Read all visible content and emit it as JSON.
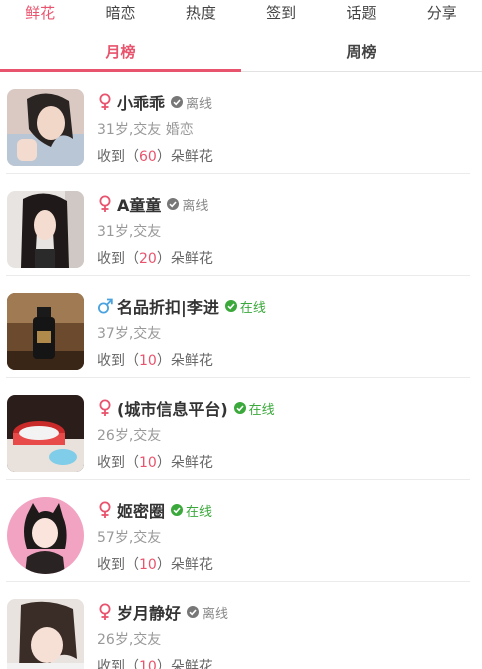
{
  "top_tabs": [
    "鲜花",
    "暗恋",
    "热度",
    "签到",
    "话题",
    "分享"
  ],
  "sub_tabs": [
    "月榜",
    "周榜"
  ],
  "colors": {
    "accent": "#e8546d",
    "online": "#3aa83a",
    "offline": "#888888",
    "female": "#e8546d",
    "male": "#4aa3df"
  },
  "labels": {
    "received_prefix": "收到（",
    "received_suffix": "）朵鲜花"
  },
  "users": [
    {
      "name": "小乖乖",
      "gender": "female",
      "gender_icon": "female-symbol-icon",
      "status": "离线",
      "status_kind": "offline",
      "info": "31岁,交友 婚恋",
      "flowers": "60"
    },
    {
      "name": "A童童",
      "gender": "female",
      "gender_icon": "female-symbol-icon",
      "status": "离线",
      "status_kind": "offline",
      "info": "31岁,交友",
      "flowers": "20"
    },
    {
      "name": "名品折扣|李进",
      "gender": "male",
      "gender_icon": "male-symbol-icon",
      "status": "在线",
      "status_kind": "online",
      "info": "37岁,交友",
      "flowers": "10"
    },
    {
      "name": "(城市信息平台)",
      "gender": "female",
      "gender_icon": "female-symbol-icon",
      "status": "在线",
      "status_kind": "online",
      "info": "26岁,交友",
      "flowers": "10"
    },
    {
      "name": "姬密圈",
      "gender": "female",
      "gender_icon": "female-symbol-icon",
      "status": "在线",
      "status_kind": "online",
      "info": "57岁,交友",
      "flowers": "10"
    },
    {
      "name": "岁月静好",
      "gender": "female",
      "gender_icon": "female-symbol-icon",
      "status": "离线",
      "status_kind": "offline",
      "info": "26岁,交友",
      "flowers": "10"
    }
  ]
}
